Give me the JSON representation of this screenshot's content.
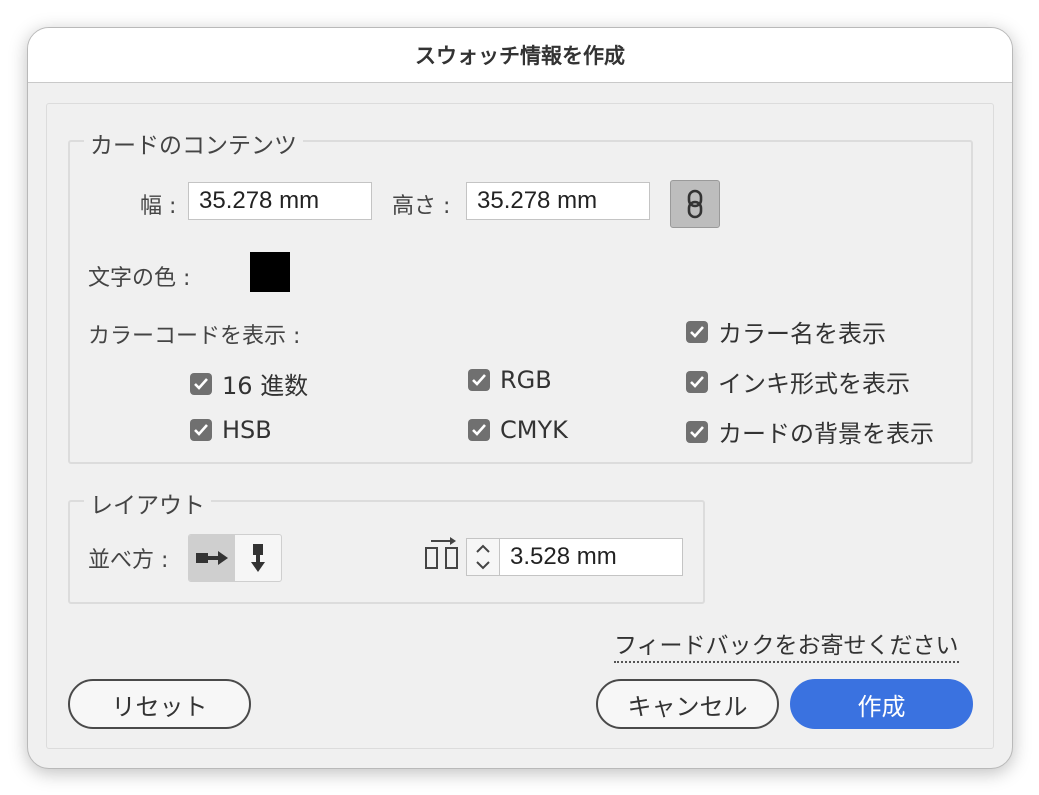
{
  "dialog": {
    "title": "スウォッチ情報を作成"
  },
  "content_group": {
    "legend": "カードのコンテンツ",
    "width_label": "幅 :",
    "width_value": "35.278 mm",
    "height_label": "高さ :",
    "height_value": "35.278 mm",
    "link_icon": "link-icon",
    "text_color_label": "文字の色 :",
    "text_color": "#000000",
    "color_code_label": "カラーコードを表示 :",
    "checkboxes": [
      {
        "label": "16 進数",
        "checked": true
      },
      {
        "label": "RGB",
        "checked": true
      },
      {
        "label": "HSB",
        "checked": true
      },
      {
        "label": "CMYK",
        "checked": true
      },
      {
        "label": "カラー名を表示",
        "checked": true
      },
      {
        "label": "インキ形式を表示",
        "checked": true
      },
      {
        "label": "カードの背景を表示",
        "checked": true
      }
    ]
  },
  "layout_group": {
    "legend": "レイアウト",
    "arrange_label": "並べ方 :",
    "arrange_options": [
      {
        "icon": "arrange-horizontal-icon",
        "selected": true
      },
      {
        "icon": "arrange-vertical-icon",
        "selected": false
      }
    ],
    "spacing_icon": "spacing-icon",
    "spacing_value": "3.528 mm"
  },
  "feedback_link": "フィードバックをお寄せください",
  "buttons": {
    "reset": "リセット",
    "cancel": "キャンセル",
    "create": "作成"
  },
  "colors": {
    "primary": "#3a72e0",
    "checkbox": "#707070"
  }
}
